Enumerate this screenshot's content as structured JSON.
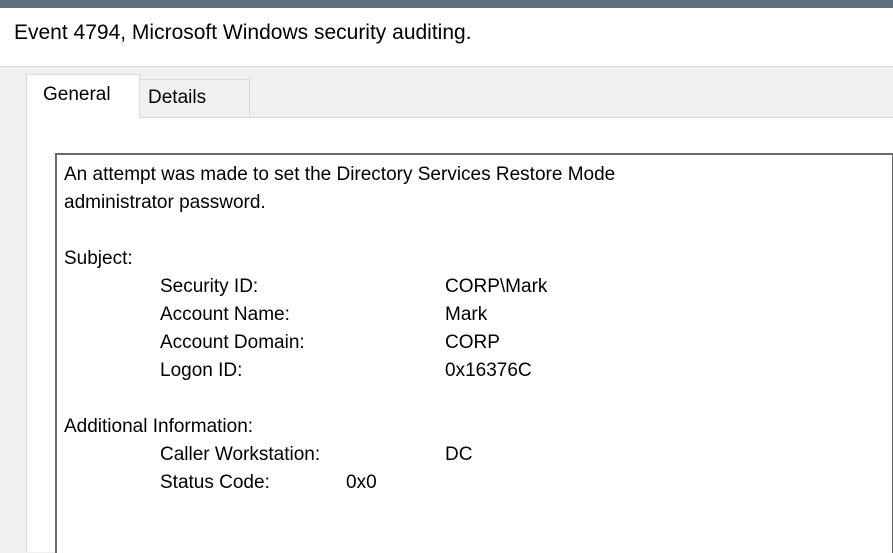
{
  "window": {
    "title": "Event 4794, Microsoft Windows security auditing."
  },
  "tabs": [
    {
      "label": "General",
      "active": true
    },
    {
      "label": "Details",
      "active": false
    }
  ],
  "description": {
    "intro_line1": "An attempt was made to set the Directory Services Restore Mode",
    "intro_line2": "administrator password.",
    "subject": {
      "heading": "Subject:",
      "fields": [
        {
          "label": "Security ID:",
          "value": "CORP\\Mark"
        },
        {
          "label": "Account Name:",
          "value": "Mark"
        },
        {
          "label": "Account Domain:",
          "value": "CORP"
        },
        {
          "label": "Logon ID:",
          "value": "0x16376C"
        }
      ]
    },
    "additional": {
      "heading": "Additional Information:",
      "fields": [
        {
          "label": "Caller Workstation:",
          "value": "DC"
        },
        {
          "label": "Status Code:",
          "value": "0x0"
        }
      ]
    }
  }
}
